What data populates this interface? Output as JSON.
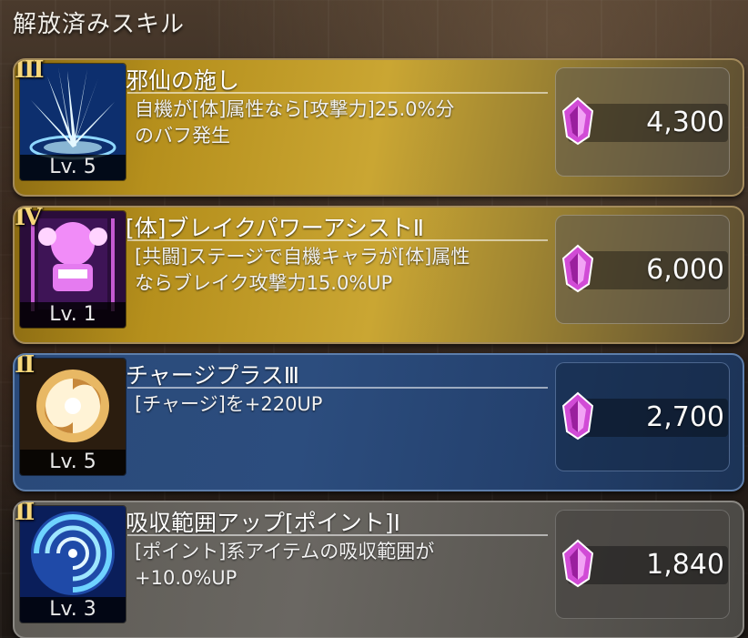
{
  "header": {
    "title": "解放済みスキル"
  },
  "skills": [
    {
      "rank": "III",
      "title": "邪仙の施し",
      "desc_lines": [
        "自機が[体]属性なら[攻撃力]25.0%分",
        "のバフ発生"
      ],
      "level": "Lv. 5",
      "cost": "4,300",
      "style": "gold",
      "icon": "spike-burst-icon"
    },
    {
      "rank": "IV",
      "title": "[体]ブレイクパワーアシストⅡ",
      "desc_lines": [
        "[共闘]ステージで自機キャラが[体]属性",
        "ならブレイク攻撃力15.0%UP"
      ],
      "level": "Lv. 1",
      "cost": "6,000",
      "style": "gold",
      "icon": "power-figure-icon"
    },
    {
      "rank": "II",
      "title": "チャージプラスⅢ",
      "desc_lines": [
        "[チャージ]を+220UP",
        ""
      ],
      "level": "Lv. 5",
      "cost": "2,700",
      "style": "blue",
      "icon": "swirl-orb-icon"
    },
    {
      "rank": "II",
      "title": "吸収範囲アップ[ポイント]Ⅰ",
      "desc_lines": [
        "[ポイント]系アイテムの吸収範囲が",
        "+10.0%UP"
      ],
      "level": "Lv. 3",
      "cost": "1,840",
      "style": "gray",
      "icon": "vortex-icon"
    }
  ],
  "colors": {
    "gold_card": "#b58f1c",
    "blue_card": "#2c4d7e",
    "gray_card": "#6a6762",
    "gem": "#d14bd6",
    "rank_text": "#f7d77a"
  }
}
